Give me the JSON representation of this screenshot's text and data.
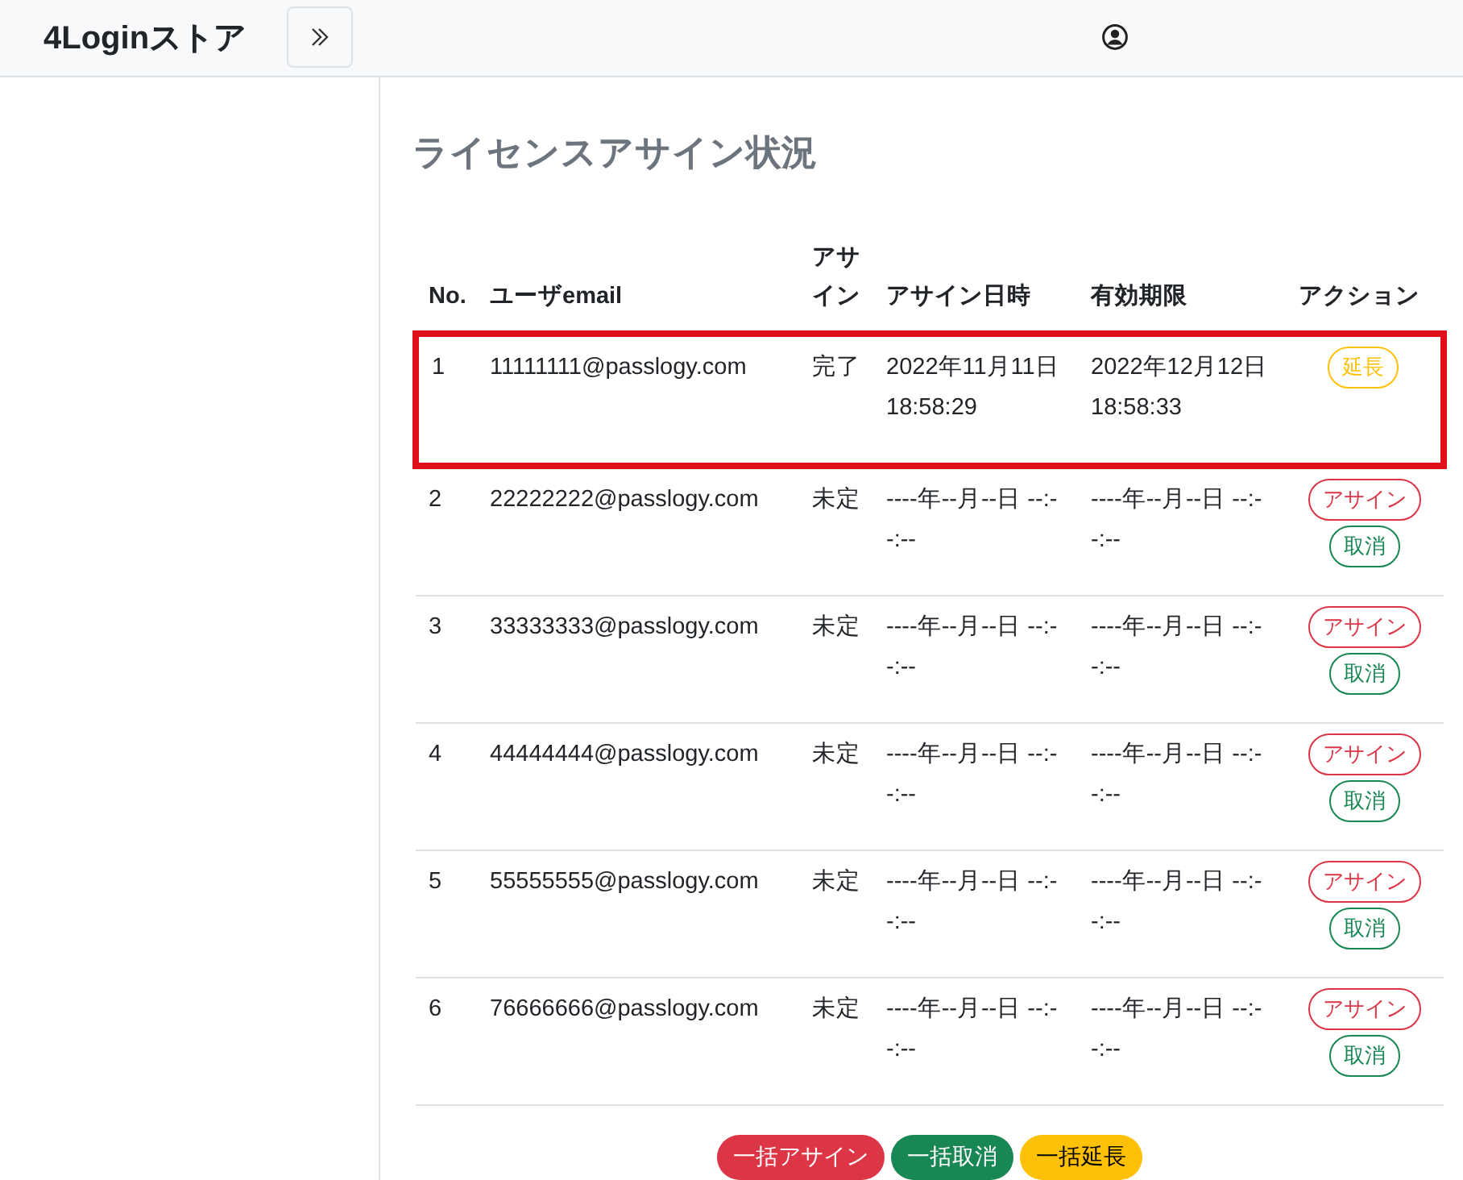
{
  "header": {
    "brand": "4Loginストア"
  },
  "page": {
    "title": "ライセンスアサイン状況"
  },
  "table": {
    "columns": [
      "No.",
      "ユーザemail",
      "アサイン",
      "アサイン日時",
      "有効期限",
      "アクション"
    ],
    "rows": [
      {
        "no": "1",
        "email": "11111111@passlogy.com",
        "status": "完了",
        "assigned_at": "2022年11月11日 18:58:29",
        "expires_at": "2022年12月12日 18:58:33",
        "highlighted": true,
        "actions": [
          {
            "kind": "extend",
            "label": "延長"
          }
        ]
      },
      {
        "no": "2",
        "email": "22222222@passlogy.com",
        "status": "未定",
        "assigned_at": "----年--月--日 --:--:--",
        "expires_at": "----年--月--日 --:--:--",
        "highlighted": false,
        "actions": [
          {
            "kind": "assign",
            "label": "アサイン"
          },
          {
            "kind": "cancel",
            "label": "取消"
          }
        ]
      },
      {
        "no": "3",
        "email": "33333333@passlogy.com",
        "status": "未定",
        "assigned_at": "----年--月--日 --:--:--",
        "expires_at": "----年--月--日 --:--:--",
        "highlighted": false,
        "actions": [
          {
            "kind": "assign",
            "label": "アサイン"
          },
          {
            "kind": "cancel",
            "label": "取消"
          }
        ]
      },
      {
        "no": "4",
        "email": "44444444@passlogy.com",
        "status": "未定",
        "assigned_at": "----年--月--日 --:--:--",
        "expires_at": "----年--月--日 --:--:--",
        "highlighted": false,
        "actions": [
          {
            "kind": "assign",
            "label": "アサイン"
          },
          {
            "kind": "cancel",
            "label": "取消"
          }
        ]
      },
      {
        "no": "5",
        "email": "55555555@passlogy.com",
        "status": "未定",
        "assigned_at": "----年--月--日 --:--:--",
        "expires_at": "----年--月--日 --:--:--",
        "highlighted": false,
        "actions": [
          {
            "kind": "assign",
            "label": "アサイン"
          },
          {
            "kind": "cancel",
            "label": "取消"
          }
        ]
      },
      {
        "no": "6",
        "email": "76666666@passlogy.com",
        "status": "未定",
        "assigned_at": "----年--月--日 --:--:--",
        "expires_at": "----年--月--日 --:--:--",
        "highlighted": false,
        "actions": [
          {
            "kind": "assign",
            "label": "アサイン"
          },
          {
            "kind": "cancel",
            "label": "取消"
          }
        ]
      }
    ]
  },
  "bulk_actions": [
    {
      "kind": "assign",
      "label": "一括アサイン"
    },
    {
      "kind": "cancel",
      "label": "一括取消"
    },
    {
      "kind": "extend",
      "label": "一括延長"
    }
  ]
}
